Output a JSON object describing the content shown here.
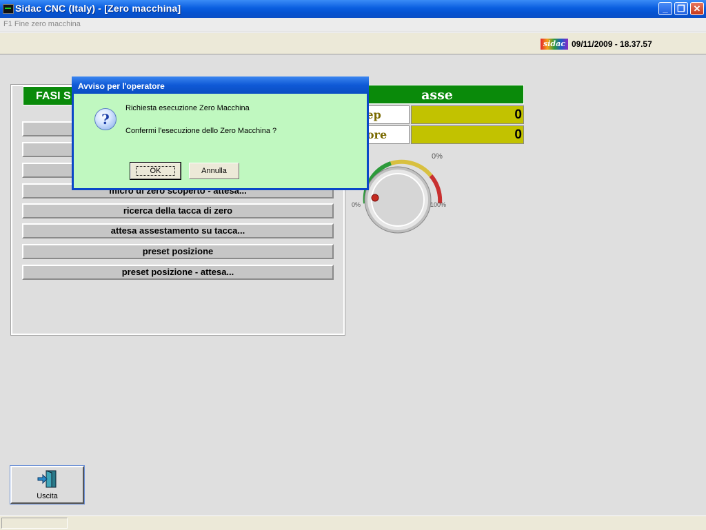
{
  "window": {
    "title": "Sidac CNC (Italy) - [Zero macchina]",
    "controls": {
      "minimize": "_",
      "restore": "❐",
      "close": "✕"
    }
  },
  "menu": {
    "f1": "F1 Fine zero macchina"
  },
  "info": {
    "logo": "sidac",
    "datetime": "09/11/2009 -  18.37.57"
  },
  "fasi": {
    "header": "FASI S",
    "items": [
      "",
      "",
      "",
      "micro di zero scoperto - attesa...",
      "ricerca della tacca di zero",
      "attesa assestamento su tacca...",
      "preset posizione",
      "preset posizione - attesa..."
    ]
  },
  "asse": {
    "header": "asse",
    "rows": [
      {
        "label": "step",
        "value": "0"
      },
      {
        "label": "rrore",
        "value": "0"
      }
    ]
  },
  "gauge": {
    "top_label": "0%",
    "min_label": "0%",
    "max_label": "100%",
    "value_fraction": 0
  },
  "dialog": {
    "title": "Avviso per l'operatore",
    "line1": "Richiesta esecuzione Zero Macchina",
    "line2": "Confermi l'esecuzione dello Zero Macchina ?",
    "ok": "OK",
    "cancel": "Annulla",
    "icon": "question-icon"
  },
  "exit": {
    "label": "Uscita",
    "icon": "exit-door-icon"
  },
  "colors": {
    "green_header": "#0a8a0a",
    "value_bg": "#c2c200",
    "dialog_bg": "#c0f8c0"
  }
}
